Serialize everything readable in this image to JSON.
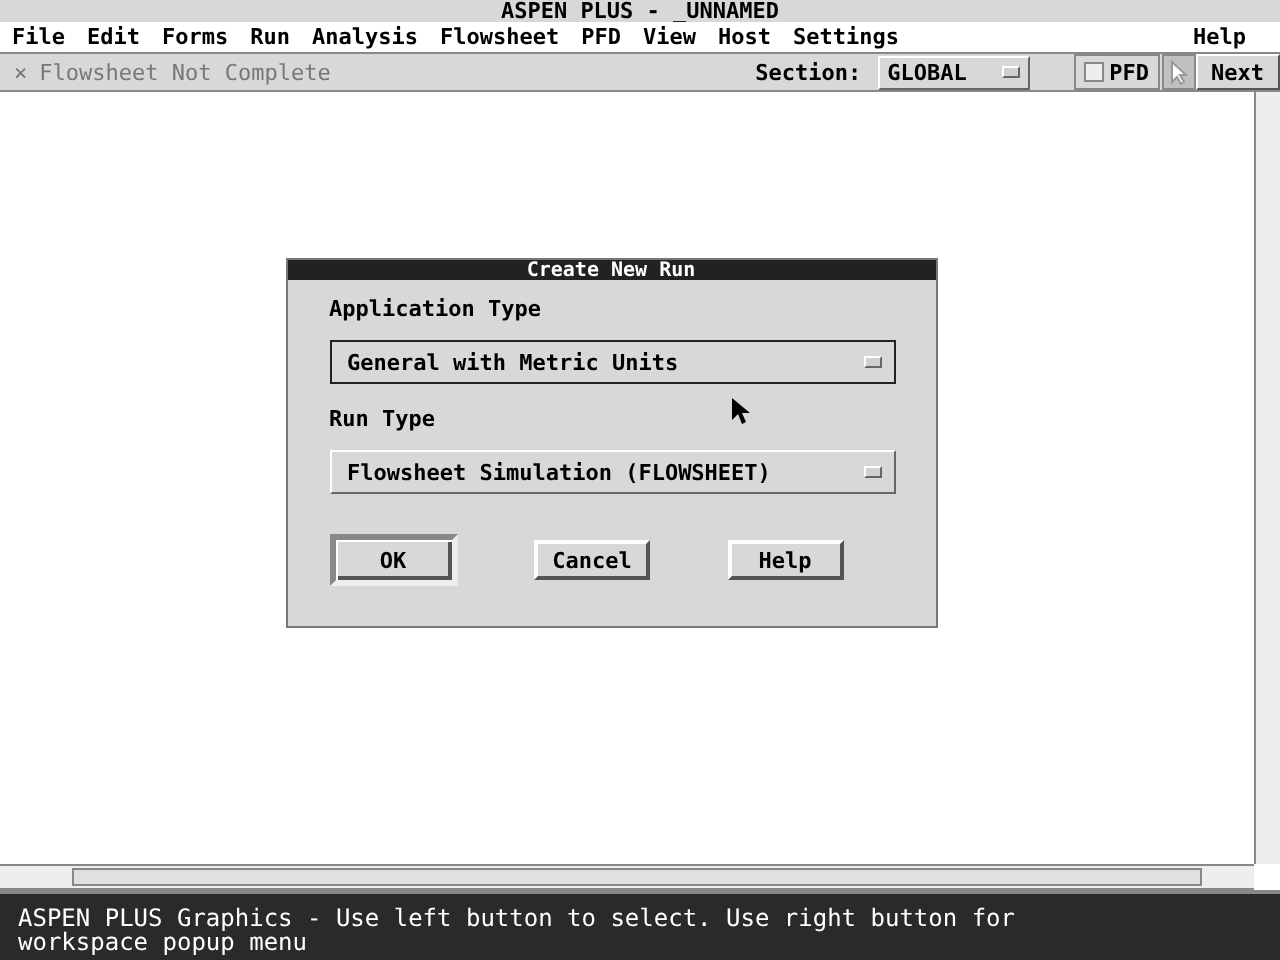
{
  "window": {
    "title": "ASPEN PLUS - _UNNAMED"
  },
  "menu": [
    "File",
    "Edit",
    "Forms",
    "Run",
    "Analysis",
    "Flowsheet",
    "PFD",
    "View",
    "Host",
    "Settings"
  ],
  "help_menu": "Help",
  "toolbar": {
    "status_mark": "×",
    "status": "Flowsheet Not Complete",
    "section_label": "Section:",
    "section_value": "GLOBAL",
    "pfd": {
      "label": "PFD",
      "checked": false
    },
    "pointer_selected": true,
    "next": "Next"
  },
  "dialog": {
    "title": "Create New Run",
    "fields": [
      {
        "label": "Application Type",
        "value": "General with Metric Units",
        "focused": true
      },
      {
        "label": "Run Type",
        "value": "Flowsheet Simulation (FLOWSHEET)",
        "focused": false
      }
    ],
    "buttons": [
      {
        "label": "OK",
        "default": true
      },
      {
        "label": "Cancel",
        "default": false
      },
      {
        "label": "Help",
        "default": false
      }
    ]
  },
  "status_bar": "ASPEN PLUS Graphics - Use left button to select. Use right button for workspace popup menu"
}
